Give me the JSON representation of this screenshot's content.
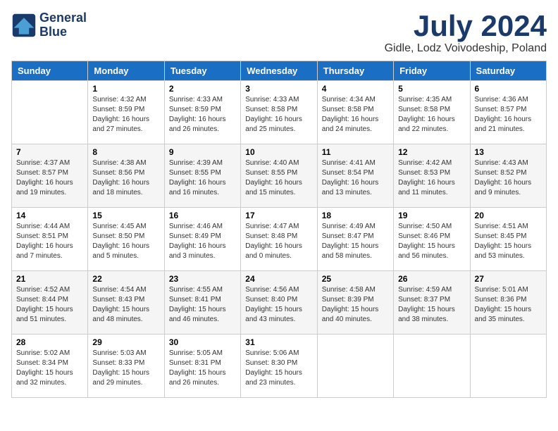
{
  "header": {
    "logo_line1": "General",
    "logo_line2": "Blue",
    "month_year": "July 2024",
    "location": "Gidle, Lodz Voivodeship, Poland"
  },
  "days_of_week": [
    "Sunday",
    "Monday",
    "Tuesday",
    "Wednesday",
    "Thursday",
    "Friday",
    "Saturday"
  ],
  "weeks": [
    [
      {
        "day": "",
        "info": ""
      },
      {
        "day": "1",
        "info": "Sunrise: 4:32 AM\nSunset: 8:59 PM\nDaylight: 16 hours\nand 27 minutes."
      },
      {
        "day": "2",
        "info": "Sunrise: 4:33 AM\nSunset: 8:59 PM\nDaylight: 16 hours\nand 26 minutes."
      },
      {
        "day": "3",
        "info": "Sunrise: 4:33 AM\nSunset: 8:58 PM\nDaylight: 16 hours\nand 25 minutes."
      },
      {
        "day": "4",
        "info": "Sunrise: 4:34 AM\nSunset: 8:58 PM\nDaylight: 16 hours\nand 24 minutes."
      },
      {
        "day": "5",
        "info": "Sunrise: 4:35 AM\nSunset: 8:58 PM\nDaylight: 16 hours\nand 22 minutes."
      },
      {
        "day": "6",
        "info": "Sunrise: 4:36 AM\nSunset: 8:57 PM\nDaylight: 16 hours\nand 21 minutes."
      }
    ],
    [
      {
        "day": "7",
        "info": "Sunrise: 4:37 AM\nSunset: 8:57 PM\nDaylight: 16 hours\nand 19 minutes."
      },
      {
        "day": "8",
        "info": "Sunrise: 4:38 AM\nSunset: 8:56 PM\nDaylight: 16 hours\nand 18 minutes."
      },
      {
        "day": "9",
        "info": "Sunrise: 4:39 AM\nSunset: 8:55 PM\nDaylight: 16 hours\nand 16 minutes."
      },
      {
        "day": "10",
        "info": "Sunrise: 4:40 AM\nSunset: 8:55 PM\nDaylight: 16 hours\nand 15 minutes."
      },
      {
        "day": "11",
        "info": "Sunrise: 4:41 AM\nSunset: 8:54 PM\nDaylight: 16 hours\nand 13 minutes."
      },
      {
        "day": "12",
        "info": "Sunrise: 4:42 AM\nSunset: 8:53 PM\nDaylight: 16 hours\nand 11 minutes."
      },
      {
        "day": "13",
        "info": "Sunrise: 4:43 AM\nSunset: 8:52 PM\nDaylight: 16 hours\nand 9 minutes."
      }
    ],
    [
      {
        "day": "14",
        "info": "Sunrise: 4:44 AM\nSunset: 8:51 PM\nDaylight: 16 hours\nand 7 minutes."
      },
      {
        "day": "15",
        "info": "Sunrise: 4:45 AM\nSunset: 8:50 PM\nDaylight: 16 hours\nand 5 minutes."
      },
      {
        "day": "16",
        "info": "Sunrise: 4:46 AM\nSunset: 8:49 PM\nDaylight: 16 hours\nand 3 minutes."
      },
      {
        "day": "17",
        "info": "Sunrise: 4:47 AM\nSunset: 8:48 PM\nDaylight: 16 hours\nand 0 minutes."
      },
      {
        "day": "18",
        "info": "Sunrise: 4:49 AM\nSunset: 8:47 PM\nDaylight: 15 hours\nand 58 minutes."
      },
      {
        "day": "19",
        "info": "Sunrise: 4:50 AM\nSunset: 8:46 PM\nDaylight: 15 hours\nand 56 minutes."
      },
      {
        "day": "20",
        "info": "Sunrise: 4:51 AM\nSunset: 8:45 PM\nDaylight: 15 hours\nand 53 minutes."
      }
    ],
    [
      {
        "day": "21",
        "info": "Sunrise: 4:52 AM\nSunset: 8:44 PM\nDaylight: 15 hours\nand 51 minutes."
      },
      {
        "day": "22",
        "info": "Sunrise: 4:54 AM\nSunset: 8:43 PM\nDaylight: 15 hours\nand 48 minutes."
      },
      {
        "day": "23",
        "info": "Sunrise: 4:55 AM\nSunset: 8:41 PM\nDaylight: 15 hours\nand 46 minutes."
      },
      {
        "day": "24",
        "info": "Sunrise: 4:56 AM\nSunset: 8:40 PM\nDaylight: 15 hours\nand 43 minutes."
      },
      {
        "day": "25",
        "info": "Sunrise: 4:58 AM\nSunset: 8:39 PM\nDaylight: 15 hours\nand 40 minutes."
      },
      {
        "day": "26",
        "info": "Sunrise: 4:59 AM\nSunset: 8:37 PM\nDaylight: 15 hours\nand 38 minutes."
      },
      {
        "day": "27",
        "info": "Sunrise: 5:01 AM\nSunset: 8:36 PM\nDaylight: 15 hours\nand 35 minutes."
      }
    ],
    [
      {
        "day": "28",
        "info": "Sunrise: 5:02 AM\nSunset: 8:34 PM\nDaylight: 15 hours\nand 32 minutes."
      },
      {
        "day": "29",
        "info": "Sunrise: 5:03 AM\nSunset: 8:33 PM\nDaylight: 15 hours\nand 29 minutes."
      },
      {
        "day": "30",
        "info": "Sunrise: 5:05 AM\nSunset: 8:31 PM\nDaylight: 15 hours\nand 26 minutes."
      },
      {
        "day": "31",
        "info": "Sunrise: 5:06 AM\nSunset: 8:30 PM\nDaylight: 15 hours\nand 23 minutes."
      },
      {
        "day": "",
        "info": ""
      },
      {
        "day": "",
        "info": ""
      },
      {
        "day": "",
        "info": ""
      }
    ]
  ]
}
